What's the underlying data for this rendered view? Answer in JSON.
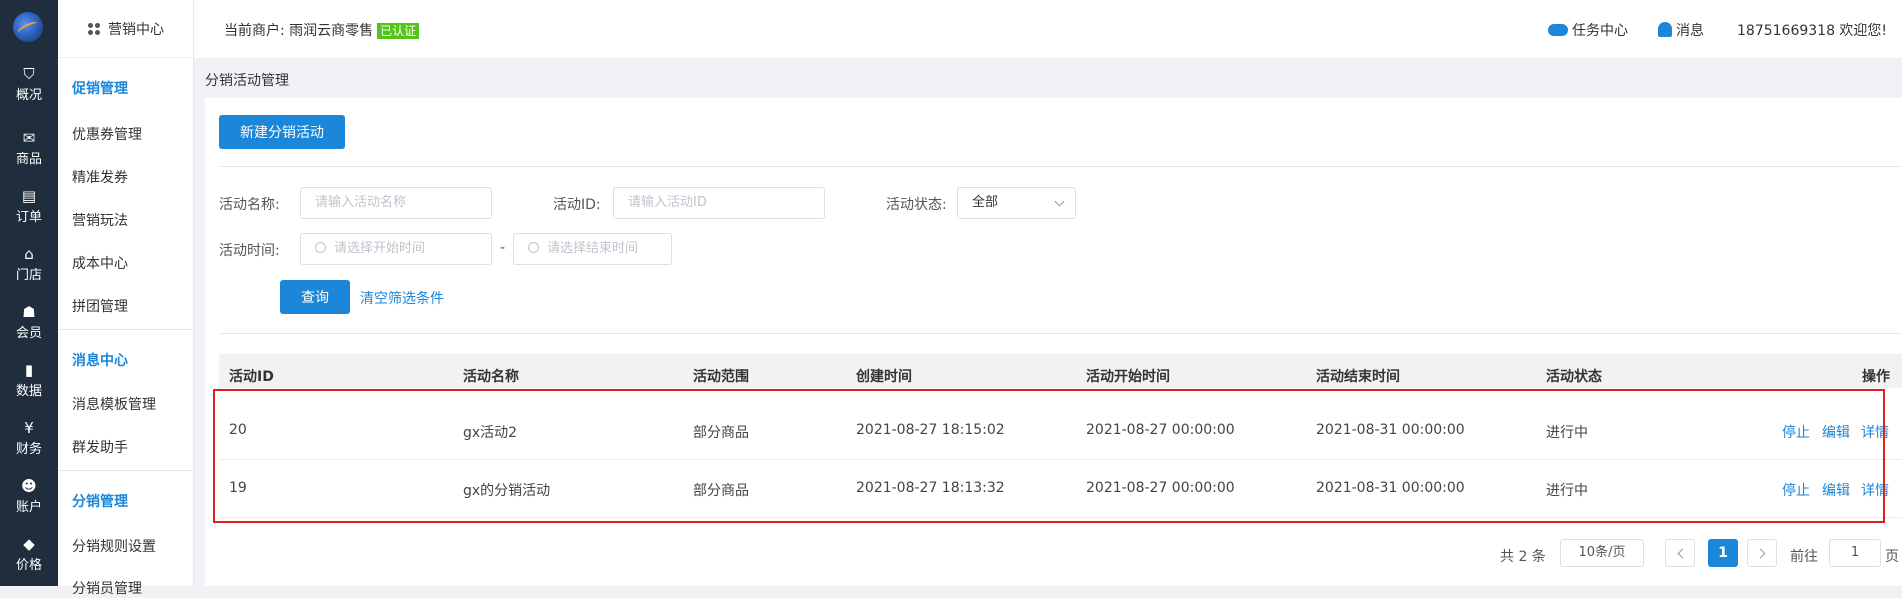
{
  "rail": {
    "items": [
      {
        "label": "概况",
        "icon": "dashboard-icon",
        "glyph": "⛉"
      },
      {
        "label": "商品",
        "icon": "goods-icon",
        "glyph": "✉"
      },
      {
        "label": "订单",
        "icon": "order-icon",
        "glyph": "▤"
      },
      {
        "label": "门店",
        "icon": "store-icon",
        "glyph": "⌂"
      },
      {
        "label": "会员",
        "icon": "member-icon",
        "glyph": "☗"
      },
      {
        "label": "数据",
        "icon": "data-icon",
        "glyph": "▮"
      },
      {
        "label": "财务",
        "icon": "finance-icon",
        "glyph": "¥"
      },
      {
        "label": "账户",
        "icon": "account-icon",
        "glyph": "☻"
      },
      {
        "label": "价格",
        "icon": "price-icon",
        "glyph": "◆"
      }
    ]
  },
  "sidebar": {
    "title": "营销中心",
    "sections": [
      {
        "title": "促销管理",
        "items": [
          "优惠券管理",
          "精准发券",
          "营销玩法",
          "成本中心",
          "拼团管理"
        ]
      },
      {
        "title": "消息中心",
        "items": [
          "消息模板管理",
          "群发助手"
        ]
      },
      {
        "title": "分销管理",
        "items": [
          "分销规则设置",
          "分销员管理"
        ]
      }
    ]
  },
  "header": {
    "merchant_label": "当前商户: 雨润云商零售",
    "cert_badge": "已认证",
    "task_center": "任务中心",
    "messages": "消息",
    "welcome": "18751669318 欢迎您!"
  },
  "breadcrumb": "分销活动管理",
  "toolbar": {
    "new_button": "新建分销活动"
  },
  "filters": {
    "name_label": "活动名称:",
    "name_placeholder": "请输入活动名称",
    "id_label": "活动ID:",
    "id_placeholder": "请输入活动ID",
    "status_label": "活动状态:",
    "status_value": "全部",
    "time_label": "活动时间:",
    "start_placeholder": "请选择开始时间",
    "range_sep": "-",
    "end_placeholder": "请选择结束时间",
    "query_button": "查询",
    "clear_link": "清空筛选条件"
  },
  "table": {
    "headers": [
      "活动ID",
      "活动名称",
      "活动范围",
      "创建时间",
      "活动开始时间",
      "活动结束时间",
      "活动状态",
      "操作"
    ],
    "rows": [
      {
        "id": "20",
        "name": "gx活动2",
        "scope": "部分商品",
        "created": "2021-08-27 18:15:02",
        "start": "2021-08-27 00:00:00",
        "end": "2021-08-31 00:00:00",
        "status": "进行中",
        "ops": [
          "停止",
          "编辑",
          "详情"
        ]
      },
      {
        "id": "19",
        "name": "gx的分销活动",
        "scope": "部分商品",
        "created": "2021-08-27 18:13:32",
        "start": "2021-08-27 00:00:00",
        "end": "2021-08-31 00:00:00",
        "status": "进行中",
        "ops": [
          "停止",
          "编辑",
          "详情"
        ]
      }
    ]
  },
  "pagination": {
    "total": "共 2 条",
    "page_size": "10条/页",
    "current": "1",
    "goto_label": "前往",
    "goto_value": "1",
    "page_suffix": "页"
  },
  "colors": {
    "accent": "#1c86d8",
    "rail_bg": "#1f2d3d",
    "badge_green": "#52c41a",
    "highlight_red": "#e02020"
  }
}
